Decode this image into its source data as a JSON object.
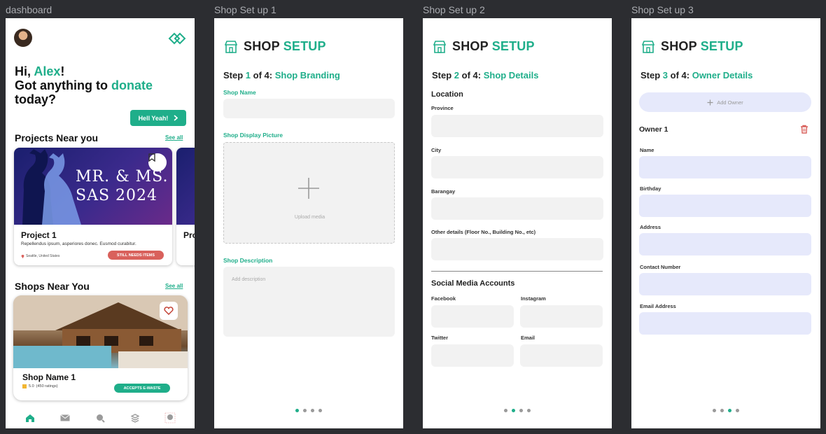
{
  "frames": {
    "dashboard": "dashboard",
    "setup1": "Shop Set up 1",
    "setup2": "Shop Set up 2",
    "setup3": "Shop Set up 3"
  },
  "dashboard": {
    "greeting_hi": "Hi, ",
    "greeting_name": "Alex",
    "greeting_excl": "!",
    "greeting_line2a": "Got anything to ",
    "greeting_donate": "donate",
    "greeting_line3": "today?",
    "cta_label": "Hell Yeah!",
    "projects_title": "Projects Near you",
    "projects_see_all": "See all",
    "project": {
      "poster_line1": "MR. & MS.",
      "poster_line2": "SAS 2024",
      "name": "Project 1",
      "description": "Repellendus ipsum, asperiores donec. Eusmod curabitur.",
      "location": "Seattle, United States",
      "status": "STILL NEEDS ITEMS"
    },
    "project2_name_partial": "Pro",
    "shops_title": "Shops Near You",
    "shops_see_all": "See all",
    "shop": {
      "name": "Shop Name 1",
      "rating": "5.0",
      "rating_count": "(450 ratings)",
      "tag": "ACCEPTS E-WASTE"
    },
    "tabs": [
      "home",
      "mail",
      "search",
      "layers",
      "profile"
    ]
  },
  "setup_title_a": "SHOP",
  "setup_title_b": "SETUP",
  "step_word": "Step ",
  "step_of": " of 4: ",
  "setup1": {
    "step_num": "1",
    "step_name": "Shop Branding",
    "shop_name_label": "Shop Name",
    "display_pic_label": "Shop Display Picture",
    "upload_text": "Upload media",
    "description_label": "Shop Description",
    "description_placeholder": "Add description"
  },
  "setup2": {
    "step_num": "2",
    "step_name": "Shop Details",
    "location_heading": "Location",
    "province_label": "Province",
    "city_label": "City",
    "barangay_label": "Barangay",
    "other_label": "Other details (Floor No., Building No., etc)",
    "social_heading": "Social Media Accounts",
    "facebook_label": "Facebook",
    "instagram_label": "Instagram",
    "twitter_label": "Twitter",
    "email_label": "Email"
  },
  "setup3": {
    "step_num": "3",
    "step_name": "Owner Details",
    "add_owner": "Add Owner",
    "owner_heading": "Owner 1",
    "name_label": "Name",
    "birthday_label": "Birthday",
    "address_label": "Address",
    "contact_label": "Contact Number",
    "email_label": "Email Address"
  },
  "pagination": {
    "total": 4,
    "setup1_active": 1,
    "setup2_active": 2,
    "setup3_active": 3
  },
  "colors": {
    "accent": "#1fae8a",
    "danger": "#d9615c",
    "field": "#f2f2f2",
    "field_blue": "#e6e9fb",
    "canvas": "#2c2d31"
  }
}
